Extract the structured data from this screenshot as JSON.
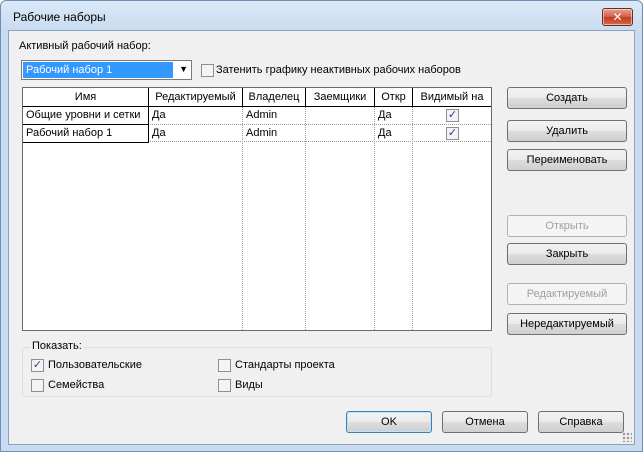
{
  "window": {
    "title": "Рабочие наборы",
    "close_glyph": "✕"
  },
  "active": {
    "label": "Активный рабочий набор:",
    "selected": "Рабочий набор 1",
    "dim_label": "Затенить графику неактивных рабочих наборов",
    "dim_checked": false
  },
  "table": {
    "columns": [
      "Имя",
      "Редактируемый",
      "Владелец",
      "Заемщики",
      "Откр",
      "Видимый на"
    ],
    "rows": [
      {
        "name": "Общие уровни и сетки",
        "editable": "Да",
        "owner": "Admin",
        "borrowers": "",
        "open": "Да",
        "visible": true
      },
      {
        "name": "Рабочий набор 1",
        "editable": "Да",
        "owner": "Admin",
        "borrowers": "",
        "open": "Да",
        "visible": true
      }
    ]
  },
  "side_buttons": {
    "create": "Создать",
    "delete": "Удалить",
    "rename": "Переименовать",
    "open": "Открыть",
    "close": "Закрыть",
    "editable": "Редактируемый",
    "non_editable": "Нередактируемый"
  },
  "show": {
    "title": "Показать:",
    "user": "Пользовательские",
    "user_checked": true,
    "standards": "Стандарты проекта",
    "standards_checked": false,
    "families": "Семейства",
    "families_checked": false,
    "views": "Виды",
    "views_checked": false
  },
  "footer": {
    "ok": "OK",
    "cancel": "Отмена",
    "help": "Справка"
  },
  "check_glyph": "✓"
}
